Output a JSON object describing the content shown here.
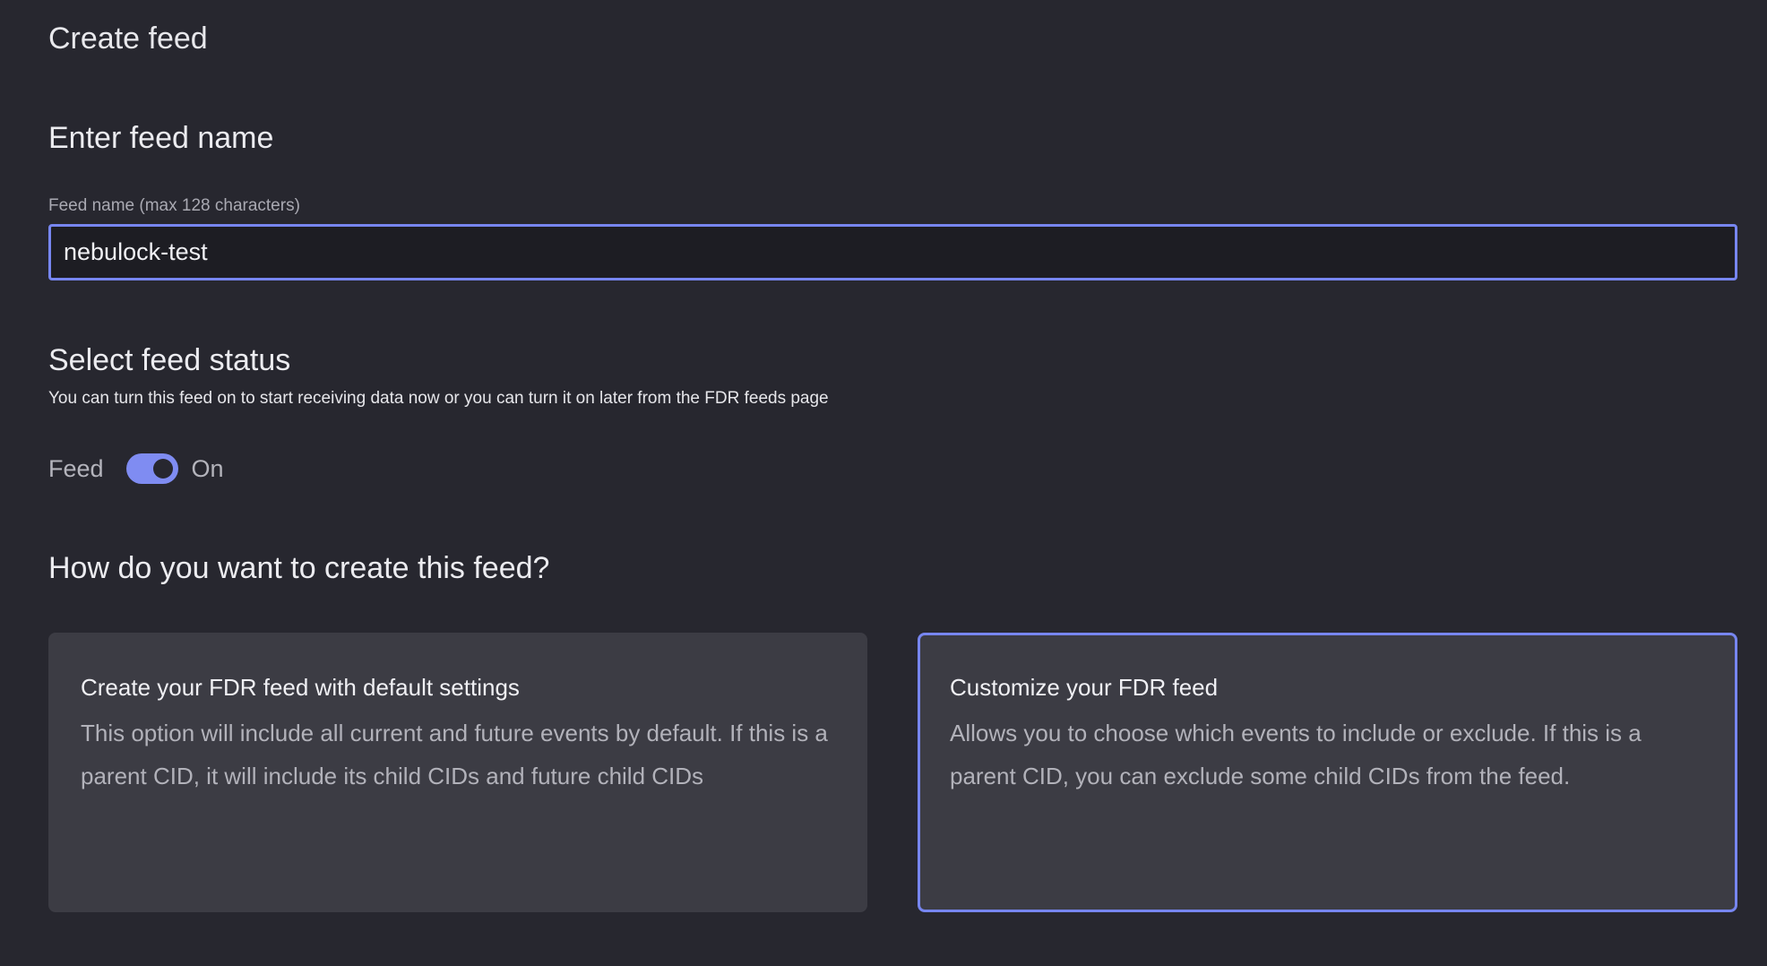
{
  "page": {
    "title": "Create feed"
  },
  "name_section": {
    "title": "Enter feed name",
    "field_label": "Feed name (max 128 characters)",
    "field_value": "nebulock-test"
  },
  "status_section": {
    "title": "Select feed status",
    "description": "You can turn this feed on to start receiving data now or you can turn it on later from the FDR feeds page",
    "toggle_label": "Feed",
    "toggle_state_label": "On",
    "toggle_on": true
  },
  "create_section": {
    "title": "How do you want to create this feed?",
    "options": [
      {
        "title": "Create your FDR feed with default settings",
        "description": "This option will include all current and future events by default. If this is a parent CID, it will include its child CIDs and future child CIDs",
        "selected": false
      },
      {
        "title": "Customize your FDR feed",
        "description": "Allows you to choose which events to include or exclude. If this is a parent CID, you can exclude some child CIDs from the feed.",
        "selected": true
      }
    ]
  },
  "colors": {
    "background": "#27272f",
    "accent": "#7786f0",
    "card": "#3c3c44"
  }
}
